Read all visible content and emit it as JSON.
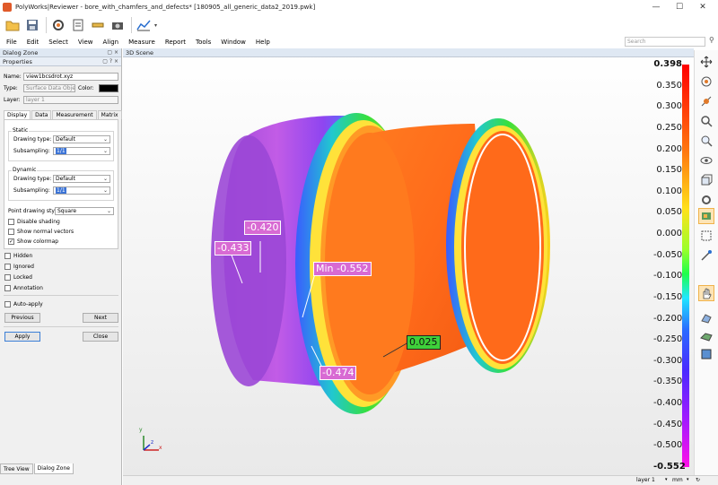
{
  "window": {
    "title": "PolyWorks|Reviewer - bore_with_chamfers_and_defects* [180905_all_generic_data2_2019.pwk]",
    "controls": {
      "minimize": "—",
      "maximize": "☐",
      "close": "✕"
    }
  },
  "menubar": {
    "items": [
      "File",
      "Edit",
      "Select",
      "View",
      "Align",
      "Measure",
      "Report",
      "Tools",
      "Window",
      "Help"
    ],
    "search_placeholder": "Search"
  },
  "dialog_zone": {
    "title": "Dialog Zone",
    "properties_title": "Properties",
    "name_label": "Name:",
    "name_value": "view1bcsdrot.xyz",
    "type_label": "Type:",
    "type_value": "Surface Data Object",
    "color_label": "Color:",
    "color_value": "#000000",
    "layer_label": "Layer:",
    "layer_value": "layer 1",
    "tabs": [
      "Display",
      "Data",
      "Measurement",
      "Matrix"
    ],
    "static_label": "Static",
    "dynamic_label": "Dynamic",
    "drawing_type_label": "Drawing type:",
    "subsampling_label": "Subsampling:",
    "static_drawing_type": "Default",
    "static_subsampling": "1/1",
    "dynamic_drawing_type": "Default",
    "dynamic_subsampling": "1/1",
    "point_drawing_style_label": "Point drawing style:",
    "point_drawing_style": "Square",
    "disable_shading": "Disable shading",
    "show_normal_vectors": "Show normal vectors",
    "show_colormap": "Show colormap",
    "hidden": "Hidden",
    "ignored": "Ignored",
    "locked": "Locked",
    "annotation": "Annotation",
    "auto_apply": "Auto-apply",
    "previous": "Previous",
    "next": "Next",
    "apply": "Apply",
    "close": "Close",
    "bottom_tabs": [
      "Tree View",
      "Dialog Zone"
    ]
  },
  "scene": {
    "title": "3D Scene",
    "annotations": [
      {
        "label": "-0.420",
        "style": "magenta"
      },
      {
        "label": "-0.433",
        "style": "magenta"
      },
      {
        "label": "Min",
        "value": "-0.552",
        "style": "magenta"
      },
      {
        "label": "0.025",
        "style": "green"
      },
      {
        "label": "-0.474",
        "style": "magenta"
      }
    ],
    "axis_labels": {
      "x": "x",
      "y": "y",
      "z": "z"
    }
  },
  "colormap": {
    "labels": [
      "0.398",
      "0.350",
      "0.300",
      "0.250",
      "0.200",
      "0.150",
      "0.100",
      "0.050",
      "0.000",
      "-0.050",
      "-0.100",
      "-0.150",
      "-0.200",
      "-0.250",
      "-0.300",
      "-0.350",
      "-0.400",
      "-0.450",
      "-0.500",
      "-0.552"
    ]
  },
  "statusbar": {
    "layer": "layer 1",
    "units": "mm"
  },
  "colors": {
    "accent": "#3c7fd6",
    "panel_header": "#dfe8f3",
    "annotation_magenta": "#d86ad3",
    "annotation_green": "#3fd03a"
  },
  "icons": [
    "open-icon",
    "save-icon",
    "settings-icon",
    "document-icon",
    "measure-icon",
    "screenshot-icon",
    "chart-icon"
  ]
}
